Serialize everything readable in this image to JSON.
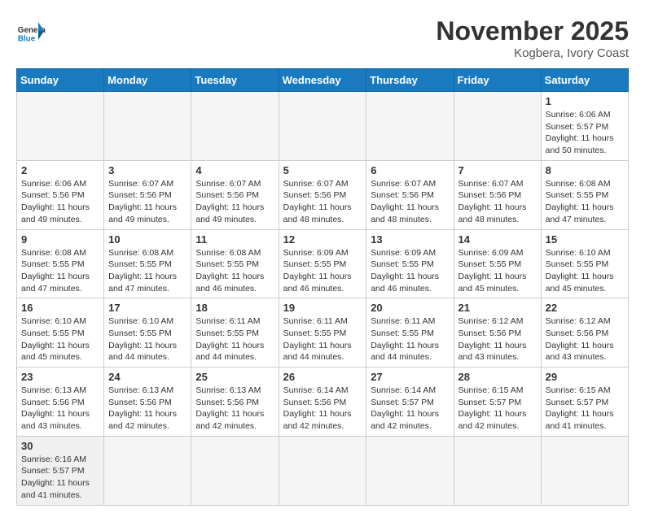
{
  "header": {
    "logo_general": "General",
    "logo_blue": "Blue",
    "month_title": "November 2025",
    "location": "Kogbera, Ivory Coast"
  },
  "weekdays": [
    "Sunday",
    "Monday",
    "Tuesday",
    "Wednesday",
    "Thursday",
    "Friday",
    "Saturday"
  ],
  "weeks": [
    [
      {
        "day": "",
        "sunrise": "",
        "sunset": "",
        "daylight": "",
        "empty": true
      },
      {
        "day": "",
        "sunrise": "",
        "sunset": "",
        "daylight": "",
        "empty": true
      },
      {
        "day": "",
        "sunrise": "",
        "sunset": "",
        "daylight": "",
        "empty": true
      },
      {
        "day": "",
        "sunrise": "",
        "sunset": "",
        "daylight": "",
        "empty": true
      },
      {
        "day": "",
        "sunrise": "",
        "sunset": "",
        "daylight": "",
        "empty": true
      },
      {
        "day": "",
        "sunrise": "",
        "sunset": "",
        "daylight": "",
        "empty": true
      },
      {
        "day": "1",
        "sunrise": "Sunrise: 6:06 AM",
        "sunset": "Sunset: 5:57 PM",
        "daylight": "Daylight: 11 hours and 50 minutes.",
        "empty": false
      }
    ],
    [
      {
        "day": "2",
        "sunrise": "Sunrise: 6:06 AM",
        "sunset": "Sunset: 5:56 PM",
        "daylight": "Daylight: 11 hours and 49 minutes.",
        "empty": false
      },
      {
        "day": "3",
        "sunrise": "Sunrise: 6:07 AM",
        "sunset": "Sunset: 5:56 PM",
        "daylight": "Daylight: 11 hours and 49 minutes.",
        "empty": false
      },
      {
        "day": "4",
        "sunrise": "Sunrise: 6:07 AM",
        "sunset": "Sunset: 5:56 PM",
        "daylight": "Daylight: 11 hours and 49 minutes.",
        "empty": false
      },
      {
        "day": "5",
        "sunrise": "Sunrise: 6:07 AM",
        "sunset": "Sunset: 5:56 PM",
        "daylight": "Daylight: 11 hours and 48 minutes.",
        "empty": false
      },
      {
        "day": "6",
        "sunrise": "Sunrise: 6:07 AM",
        "sunset": "Sunset: 5:56 PM",
        "daylight": "Daylight: 11 hours and 48 minutes.",
        "empty": false
      },
      {
        "day": "7",
        "sunrise": "Sunrise: 6:07 AM",
        "sunset": "Sunset: 5:56 PM",
        "daylight": "Daylight: 11 hours and 48 minutes.",
        "empty": false
      },
      {
        "day": "8",
        "sunrise": "Sunrise: 6:08 AM",
        "sunset": "Sunset: 5:55 PM",
        "daylight": "Daylight: 11 hours and 47 minutes.",
        "empty": false
      }
    ],
    [
      {
        "day": "9",
        "sunrise": "Sunrise: 6:08 AM",
        "sunset": "Sunset: 5:55 PM",
        "daylight": "Daylight: 11 hours and 47 minutes.",
        "empty": false
      },
      {
        "day": "10",
        "sunrise": "Sunrise: 6:08 AM",
        "sunset": "Sunset: 5:55 PM",
        "daylight": "Daylight: 11 hours and 47 minutes.",
        "empty": false
      },
      {
        "day": "11",
        "sunrise": "Sunrise: 6:08 AM",
        "sunset": "Sunset: 5:55 PM",
        "daylight": "Daylight: 11 hours and 46 minutes.",
        "empty": false
      },
      {
        "day": "12",
        "sunrise": "Sunrise: 6:09 AM",
        "sunset": "Sunset: 5:55 PM",
        "daylight": "Daylight: 11 hours and 46 minutes.",
        "empty": false
      },
      {
        "day": "13",
        "sunrise": "Sunrise: 6:09 AM",
        "sunset": "Sunset: 5:55 PM",
        "daylight": "Daylight: 11 hours and 46 minutes.",
        "empty": false
      },
      {
        "day": "14",
        "sunrise": "Sunrise: 6:09 AM",
        "sunset": "Sunset: 5:55 PM",
        "daylight": "Daylight: 11 hours and 45 minutes.",
        "empty": false
      },
      {
        "day": "15",
        "sunrise": "Sunrise: 6:10 AM",
        "sunset": "Sunset: 5:55 PM",
        "daylight": "Daylight: 11 hours and 45 minutes.",
        "empty": false
      }
    ],
    [
      {
        "day": "16",
        "sunrise": "Sunrise: 6:10 AM",
        "sunset": "Sunset: 5:55 PM",
        "daylight": "Daylight: 11 hours and 45 minutes.",
        "empty": false
      },
      {
        "day": "17",
        "sunrise": "Sunrise: 6:10 AM",
        "sunset": "Sunset: 5:55 PM",
        "daylight": "Daylight: 11 hours and 44 minutes.",
        "empty": false
      },
      {
        "day": "18",
        "sunrise": "Sunrise: 6:11 AM",
        "sunset": "Sunset: 5:55 PM",
        "daylight": "Daylight: 11 hours and 44 minutes.",
        "empty": false
      },
      {
        "day": "19",
        "sunrise": "Sunrise: 6:11 AM",
        "sunset": "Sunset: 5:55 PM",
        "daylight": "Daylight: 11 hours and 44 minutes.",
        "empty": false
      },
      {
        "day": "20",
        "sunrise": "Sunrise: 6:11 AM",
        "sunset": "Sunset: 5:55 PM",
        "daylight": "Daylight: 11 hours and 44 minutes.",
        "empty": false
      },
      {
        "day": "21",
        "sunrise": "Sunrise: 6:12 AM",
        "sunset": "Sunset: 5:56 PM",
        "daylight": "Daylight: 11 hours and 43 minutes.",
        "empty": false
      },
      {
        "day": "22",
        "sunrise": "Sunrise: 6:12 AM",
        "sunset": "Sunset: 5:56 PM",
        "daylight": "Daylight: 11 hours and 43 minutes.",
        "empty": false
      }
    ],
    [
      {
        "day": "23",
        "sunrise": "Sunrise: 6:13 AM",
        "sunset": "Sunset: 5:56 PM",
        "daylight": "Daylight: 11 hours and 43 minutes.",
        "empty": false
      },
      {
        "day": "24",
        "sunrise": "Sunrise: 6:13 AM",
        "sunset": "Sunset: 5:56 PM",
        "daylight": "Daylight: 11 hours and 42 minutes.",
        "empty": false
      },
      {
        "day": "25",
        "sunrise": "Sunrise: 6:13 AM",
        "sunset": "Sunset: 5:56 PM",
        "daylight": "Daylight: 11 hours and 42 minutes.",
        "empty": false
      },
      {
        "day": "26",
        "sunrise": "Sunrise: 6:14 AM",
        "sunset": "Sunset: 5:56 PM",
        "daylight": "Daylight: 11 hours and 42 minutes.",
        "empty": false
      },
      {
        "day": "27",
        "sunrise": "Sunrise: 6:14 AM",
        "sunset": "Sunset: 5:57 PM",
        "daylight": "Daylight: 11 hours and 42 minutes.",
        "empty": false
      },
      {
        "day": "28",
        "sunrise": "Sunrise: 6:15 AM",
        "sunset": "Sunset: 5:57 PM",
        "daylight": "Daylight: 11 hours and 42 minutes.",
        "empty": false
      },
      {
        "day": "29",
        "sunrise": "Sunrise: 6:15 AM",
        "sunset": "Sunset: 5:57 PM",
        "daylight": "Daylight: 11 hours and 41 minutes.",
        "empty": false
      }
    ],
    [
      {
        "day": "30",
        "sunrise": "Sunrise: 6:16 AM",
        "sunset": "Sunset: 5:57 PM",
        "daylight": "Daylight: 11 hours and 41 minutes.",
        "empty": false
      },
      {
        "day": "",
        "sunrise": "",
        "sunset": "",
        "daylight": "",
        "empty": true
      },
      {
        "day": "",
        "sunrise": "",
        "sunset": "",
        "daylight": "",
        "empty": true
      },
      {
        "day": "",
        "sunrise": "",
        "sunset": "",
        "daylight": "",
        "empty": true
      },
      {
        "day": "",
        "sunrise": "",
        "sunset": "",
        "daylight": "",
        "empty": true
      },
      {
        "day": "",
        "sunrise": "",
        "sunset": "",
        "daylight": "",
        "empty": true
      },
      {
        "day": "",
        "sunrise": "",
        "sunset": "",
        "daylight": "",
        "empty": true
      }
    ]
  ]
}
